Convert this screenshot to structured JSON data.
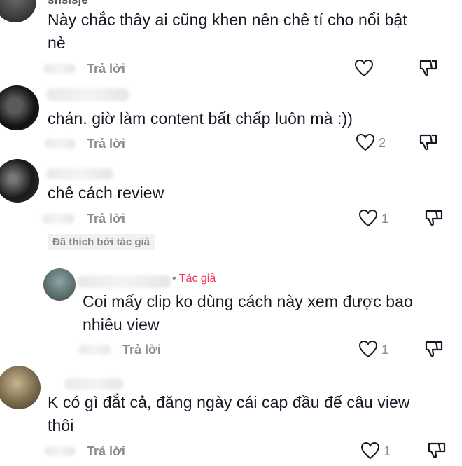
{
  "comments": [
    {
      "username": "shsisje",
      "text_line1": "Này chắc thây ai cũng khen nên chê tí cho nổi bật",
      "text_line2": "nè",
      "reply_label": "Trả lời",
      "likes": ""
    },
    {
      "text_line1": "chán. giờ làm content bất chấp luôn mà :))",
      "reply_label": "Trả lời",
      "likes": "2"
    },
    {
      "text_line1": "chê cách review",
      "reply_label": "Trả lời",
      "likes": "1",
      "badge": "Đã thích bởi tác giả"
    },
    {
      "author_tag": "Tác giả",
      "text_line1": "Coi mấy clip ko dùng cách này xem được bao",
      "text_line2": "nhiêu view",
      "reply_label": "Trả lời",
      "likes": "1"
    },
    {
      "text_line1": "K có gì đắt cả, đăng ngày cái cap đầu để câu view",
      "text_line2": "thôi",
      "reply_label": "Trả lời",
      "likes": "1"
    }
  ],
  "icons": {
    "like": "heart-icon",
    "dislike": "dislike-icon"
  }
}
